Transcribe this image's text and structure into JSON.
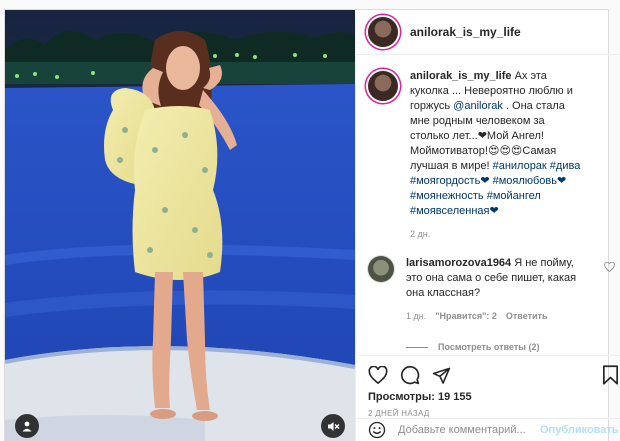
{
  "post": {
    "username": "anilorak_is_my_life",
    "caption": {
      "username": "anilorak_is_my_life",
      "text_1": "Ах эта куколка ... Невероятно люблю и горжусь",
      "mention": "@anilorak",
      "text_2": ". Она стала мне родным человеком за столько лет...❤Мой Ангел! Моймотиватор!😍😍😍Самая лучшая в мире!",
      "hashtags": "#анилорак #дива #моягордость❤ #моялюбовь❤ #моянежность #мойангел #моявселенная❤",
      "time": "2 дн."
    },
    "comment": {
      "username": "larisamorozova1964",
      "text": "Я не пойму, это она сама о себе пишет, какая она классная?",
      "time": "1 дн.",
      "likes": "\"Нравится\": 2",
      "reply": "Ответить",
      "view_replies": "Посмотреть ответы (2)"
    },
    "views": "Просмотры: 19 155",
    "date_ago": "2 ДНЕЙ НАЗАД",
    "add_comment_placeholder": "Добавьте комментарий...",
    "publish": "Опубликовать"
  },
  "icons": {
    "header_avatar": "profile-avatar",
    "like": "heart-icon",
    "comment": "comment-bubble-icon",
    "share": "paper-plane-icon",
    "save": "bookmark-icon",
    "emoji": "smiley-icon",
    "user_tag": "user-icon",
    "mute": "speaker-muted-icon"
  },
  "colors": {
    "link": "#00376b",
    "muted_text": "#8e8e8e",
    "publish_disabled": "#b2dffc",
    "story_ring": "#d6249f"
  }
}
